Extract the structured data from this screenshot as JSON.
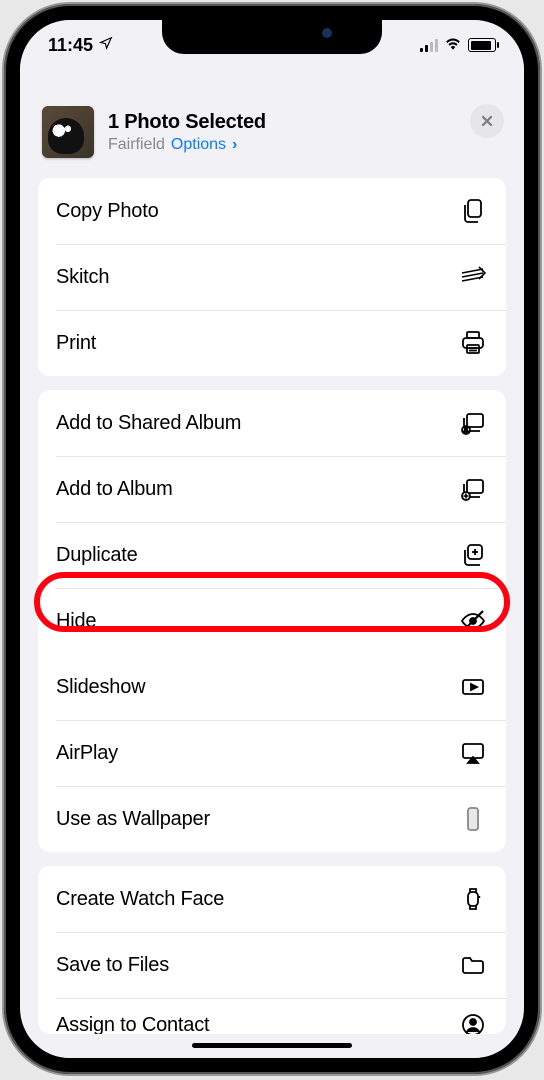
{
  "status": {
    "time": "11:45"
  },
  "header": {
    "title": "1 Photo Selected",
    "subtitle_location": "Fairfield",
    "subtitle_options": "Options",
    "subtitle_chevron": "›"
  },
  "groups": [
    {
      "items": [
        {
          "label": "Copy Photo",
          "icon": "copy-icon"
        },
        {
          "label": "Skitch",
          "icon": "skitch-icon"
        },
        {
          "label": "Print",
          "icon": "print-icon"
        }
      ]
    },
    {
      "items": [
        {
          "label": "Add to Shared Album",
          "icon": "shared-album-icon"
        },
        {
          "label": "Add to Album",
          "icon": "add-album-icon"
        },
        {
          "label": "Duplicate",
          "icon": "duplicate-icon"
        },
        {
          "label": "Hide",
          "icon": "hide-icon",
          "highlighted": true
        },
        {
          "label": "Slideshow",
          "icon": "play-rect-icon"
        },
        {
          "label": "AirPlay",
          "icon": "airplay-icon"
        },
        {
          "label": "Use as Wallpaper",
          "icon": "phone-rect-icon"
        }
      ]
    },
    {
      "items": [
        {
          "label": "Create Watch Face",
          "icon": "watch-icon"
        },
        {
          "label": "Save to Files",
          "icon": "folder-icon"
        },
        {
          "label": "Assign to Contact",
          "icon": "contact-icon",
          "cut": true
        }
      ]
    }
  ],
  "annotation": {
    "highlighted_action": "Hide"
  }
}
